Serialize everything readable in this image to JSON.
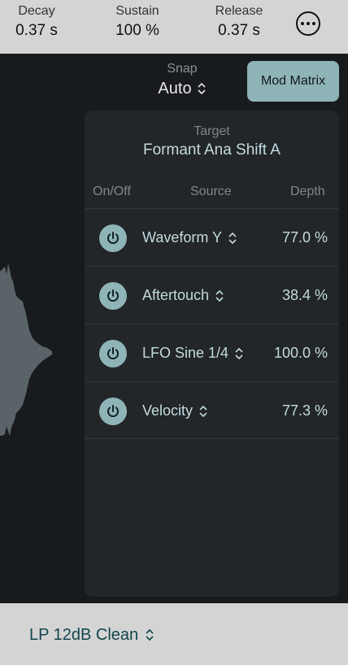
{
  "envelope": {
    "decay": {
      "label": "Decay",
      "value": "0.37 s"
    },
    "sustain": {
      "label": "Sustain",
      "value": "100 %"
    },
    "release": {
      "label": "Release",
      "value": "0.37 s"
    }
  },
  "snap": {
    "label": "Snap",
    "value": "Auto"
  },
  "mod_matrix_label": "Mod Matrix",
  "target": {
    "label": "Target",
    "value": "Formant Ana Shift A"
  },
  "columns": {
    "onoff": "On/Off",
    "source": "Source",
    "depth": "Depth"
  },
  "rows": [
    {
      "source": "Waveform Y",
      "depth": "77.0 %",
      "enabled": true
    },
    {
      "source": "Aftertouch",
      "depth": "38.4 %",
      "enabled": true
    },
    {
      "source": "LFO Sine 1/4",
      "depth": "100.0 %",
      "enabled": true
    },
    {
      "source": "Velocity",
      "depth": "77.3 %",
      "enabled": true
    }
  ],
  "filter": {
    "value": "LP 12dB Clean"
  },
  "colors": {
    "accent": "#8fb4b8",
    "panel": "#232629",
    "background": "#181b1e",
    "bar": "#d4d4d4",
    "text_accent": "#c2dadd",
    "filter_text": "#14454c"
  },
  "icons": {
    "more": "ellipsis-circle-icon",
    "power": "power-icon",
    "updown": "chevron-up-down-icon"
  }
}
